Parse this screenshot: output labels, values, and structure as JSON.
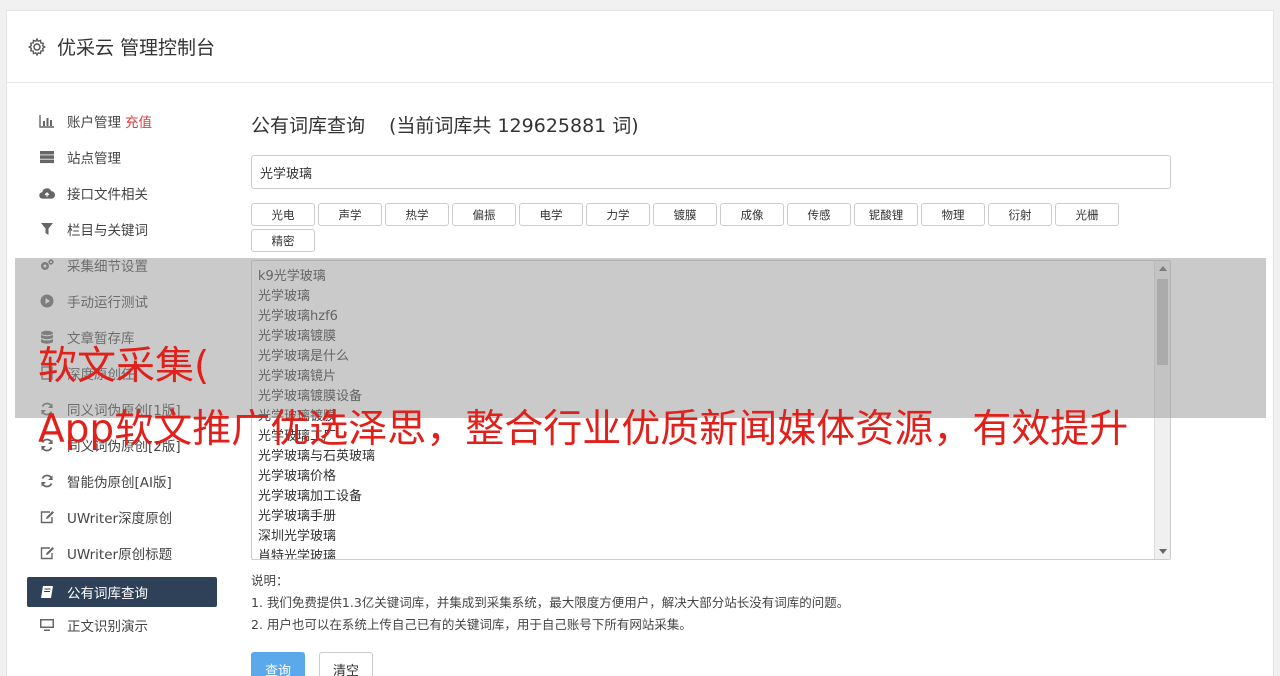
{
  "header": {
    "icon": "gear-icon",
    "title": "优采云 管理控制台"
  },
  "sidebar": {
    "items": [
      {
        "icon": "bar-chart-icon",
        "label": "账户管理",
        "extra": "充值"
      },
      {
        "icon": "server-icon",
        "label": "站点管理"
      },
      {
        "icon": "cloud-upload-icon",
        "label": "接口文件相关"
      },
      {
        "icon": "filter-icon",
        "label": "栏目与关键词"
      },
      {
        "icon": "cogs-icon",
        "label": "采集细节设置"
      },
      {
        "icon": "play-circle-icon",
        "label": "手动运行测试"
      },
      {
        "icon": "database-icon",
        "label": "文章暂存库"
      },
      {
        "icon": "file-icon",
        "label": "深度原创任"
      },
      {
        "icon": "refresh-icon",
        "label": "同义词伪原创[1版]"
      },
      {
        "icon": "refresh-icon",
        "label": "同义词伪原创[2版]"
      },
      {
        "icon": "refresh-icon",
        "label": "智能伪原创[AI版]"
      },
      {
        "icon": "edit-icon",
        "label": "UWriter深度原创"
      },
      {
        "icon": "edit-icon",
        "label": "UWriter原创标题"
      },
      {
        "icon": "book-icon",
        "label": "公有词库查询",
        "active": true
      },
      {
        "icon": "monitor-icon",
        "label": "正文识别演示"
      }
    ]
  },
  "main": {
    "title": "公有词库查询",
    "count_text": "(当前词库共 129625881 词)",
    "search_value": "光学玻璃",
    "tags": [
      "光电",
      "声学",
      "热学",
      "偏振",
      "电学",
      "力学",
      "镀膜",
      "成像",
      "传感",
      "铌酸锂",
      "物理",
      "衍射",
      "光栅",
      "精密"
    ],
    "results": [
      "k9光学玻璃",
      "光学玻璃",
      "光学玻璃hzf6",
      "光学玻璃镀膜",
      "光学玻璃是什么",
      "光学玻璃镜片",
      "光学玻璃镀膜设备",
      "光学玻璃镀膜",
      "光学玻璃工厂",
      "光学玻璃与石英玻璃",
      "光学玻璃价格",
      "光学玻璃加工设备",
      "光学玻璃手册",
      "深圳光学玻璃",
      "肖特光学玻璃"
    ],
    "notes_title": "说明：",
    "notes": [
      "1. 我们免费提供1.3亿关键词库，并集成到采集系统，最大限度方便用户，解决大部分站长没有词库的问题。",
      "2. 用户也可以在系统上传自己已有的关键词库，用于自己账号下所有网站采集。"
    ],
    "query_button": "查询",
    "clear_button": "清空"
  },
  "overlay": {
    "line1": "软文采集(",
    "line2": "App软文推广优选泽思，整合行业优质新闻媒体资源，有效提升"
  },
  "colors": {
    "active_bg": "#2f4159",
    "primary": "#5aa9ea",
    "accent_red": "#e4393c"
  }
}
